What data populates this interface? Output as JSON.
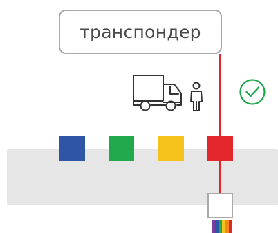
{
  "transponder_label": "транспондер",
  "colors": {
    "signal": "#e3262c",
    "road": "#e6e6e6",
    "check": "#1aa84b",
    "box_border": "#a9a9a9",
    "icon_stroke": "#333333"
  },
  "squares": [
    {
      "color": "#2f56a6"
    },
    {
      "color": "#22a94c"
    },
    {
      "color": "#f5c11b"
    },
    {
      "color": "#e3262c"
    }
  ],
  "reader_stripes": [
    "#7b3fa0",
    "#2f56a6",
    "#22a94c",
    "#f5c11b",
    "#f08a1c",
    "#e3262c"
  ],
  "icons": {
    "truck": "truck-icon",
    "person": "person-icon",
    "check": "check-circle-icon"
  }
}
